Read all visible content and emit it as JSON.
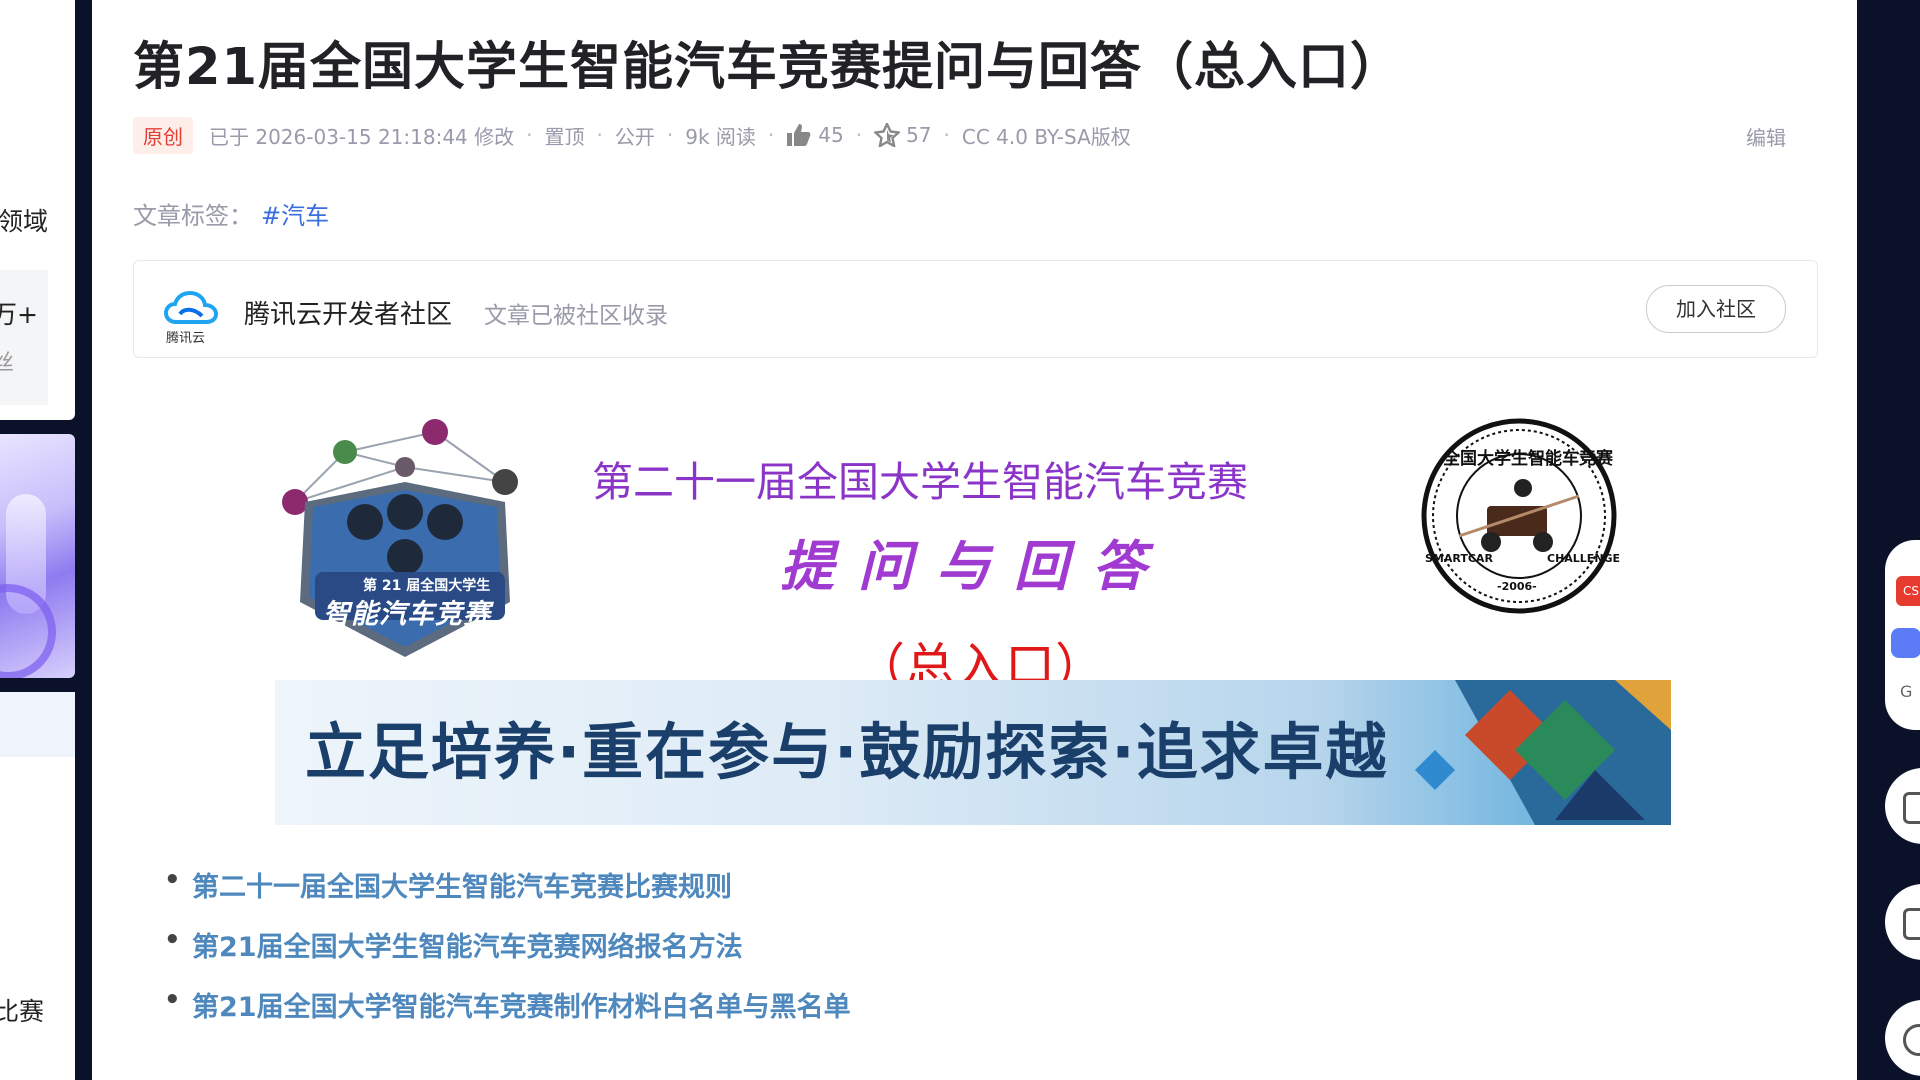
{
  "left_sidebar": {
    "fragment_1": "领域",
    "fragment_2": "万+",
    "fragment_3": "丝",
    "fragment_4": "比赛"
  },
  "article": {
    "title": "第21届全国大学生智能汽车竞赛提问与回答（总入口）",
    "meta": {
      "original_badge": "原创",
      "modified": "已于 2026-03-15 21:18:44 修改",
      "pinned": "置顶",
      "visibility": "公开",
      "reads": "9k 阅读",
      "likes": "45",
      "favorites": "57",
      "license": "CC 4.0 BY-SA版权"
    },
    "edit_label": "编辑",
    "tags_label": "文章标签：",
    "tag": "#汽车"
  },
  "community": {
    "logo_text": "腾讯云",
    "name": "腾讯云开发者社区",
    "note": "文章已被社区收录",
    "join_label": "加入社区"
  },
  "banner": {
    "line1": "第二十一届全国大学生智能汽车竞赛",
    "line2": "提问与回答",
    "line3": "（总入口）",
    "slogan": "立足培养·重在参与·鼓励探索·追求卓越",
    "badge_caption": "第 21 届全国大学生",
    "badge_title": "智能汽车竞赛",
    "seal_top": "全国大学生智能车竞赛",
    "seal_bottom_left": "SMARTCAR",
    "seal_year": "-2006-",
    "seal_bottom_right": "CHALLENGE"
  },
  "links": [
    "第二十一届全国大学生智能汽车竞赛比赛规则",
    "第21届全国大学生智能汽车竞赛网络报名方法",
    "第21届全国大学智能汽车竞赛制作材料白名单与黑名单"
  ],
  "right_rail": {
    "item_1": "CS",
    "item_3": "G"
  },
  "colors": {
    "background": "#0b1128",
    "link": "#4e88bd",
    "tag": "#3b6fe0",
    "badge": "#e33e33"
  }
}
